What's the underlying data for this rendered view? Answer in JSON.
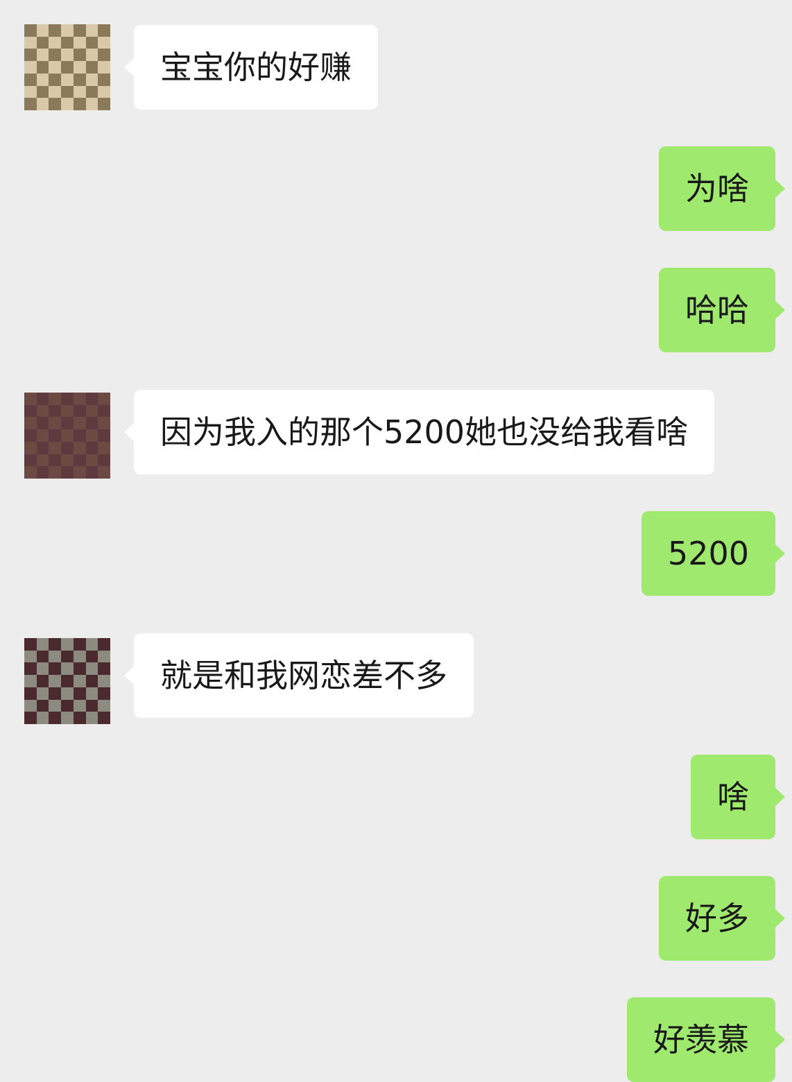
{
  "chat": {
    "messages": [
      {
        "sender": "other",
        "text": "宝宝你的好赚"
      },
      {
        "sender": "me",
        "text": "为啥"
      },
      {
        "sender": "me",
        "text": "哈哈"
      },
      {
        "sender": "other",
        "text": "因为我入的那个5200她也没给我看啥"
      },
      {
        "sender": "me",
        "text": "5200"
      },
      {
        "sender": "other",
        "text": "就是和我网恋差不多"
      },
      {
        "sender": "me",
        "text": "啥"
      },
      {
        "sender": "me",
        "text": "好多"
      },
      {
        "sender": "me",
        "text": "好羡慕"
      }
    ]
  },
  "colors": {
    "background": "#ededed",
    "incoming_bubble": "#ffffff",
    "outgoing_bubble": "#a0e96f",
    "text": "#191919"
  }
}
